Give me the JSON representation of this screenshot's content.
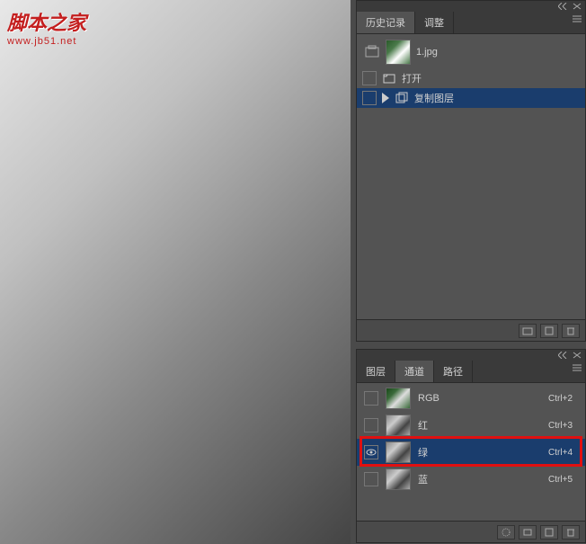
{
  "watermark": {
    "title": "脚本之家",
    "url": "www.jb51.net"
  },
  "history_panel": {
    "tabs": [
      {
        "label": "历史记录",
        "active": true
      },
      {
        "label": "调整",
        "active": false
      }
    ],
    "thumbnail_label": "1.jpg",
    "items": [
      {
        "label": "打开",
        "selected": false,
        "icon": "open"
      },
      {
        "label": "复制图层",
        "selected": true,
        "icon": "duplicate"
      }
    ]
  },
  "channels_panel": {
    "tabs": [
      {
        "label": "图层",
        "active": false
      },
      {
        "label": "通道",
        "active": true
      },
      {
        "label": "路径",
        "active": false
      }
    ],
    "channels": [
      {
        "name": "RGB",
        "shortcut": "Ctrl+2",
        "visible": false,
        "selected": false,
        "thumb": "rgb"
      },
      {
        "name": "红",
        "shortcut": "Ctrl+3",
        "visible": false,
        "selected": false,
        "thumb": "gray"
      },
      {
        "name": "绿",
        "shortcut": "Ctrl+4",
        "visible": true,
        "selected": true,
        "thumb": "gray"
      },
      {
        "name": "蓝",
        "shortcut": "Ctrl+5",
        "visible": false,
        "selected": false,
        "thumb": "gray"
      }
    ]
  },
  "tools": [
    "move",
    "text",
    "paragraph",
    "brush",
    "anchor",
    "hand"
  ]
}
